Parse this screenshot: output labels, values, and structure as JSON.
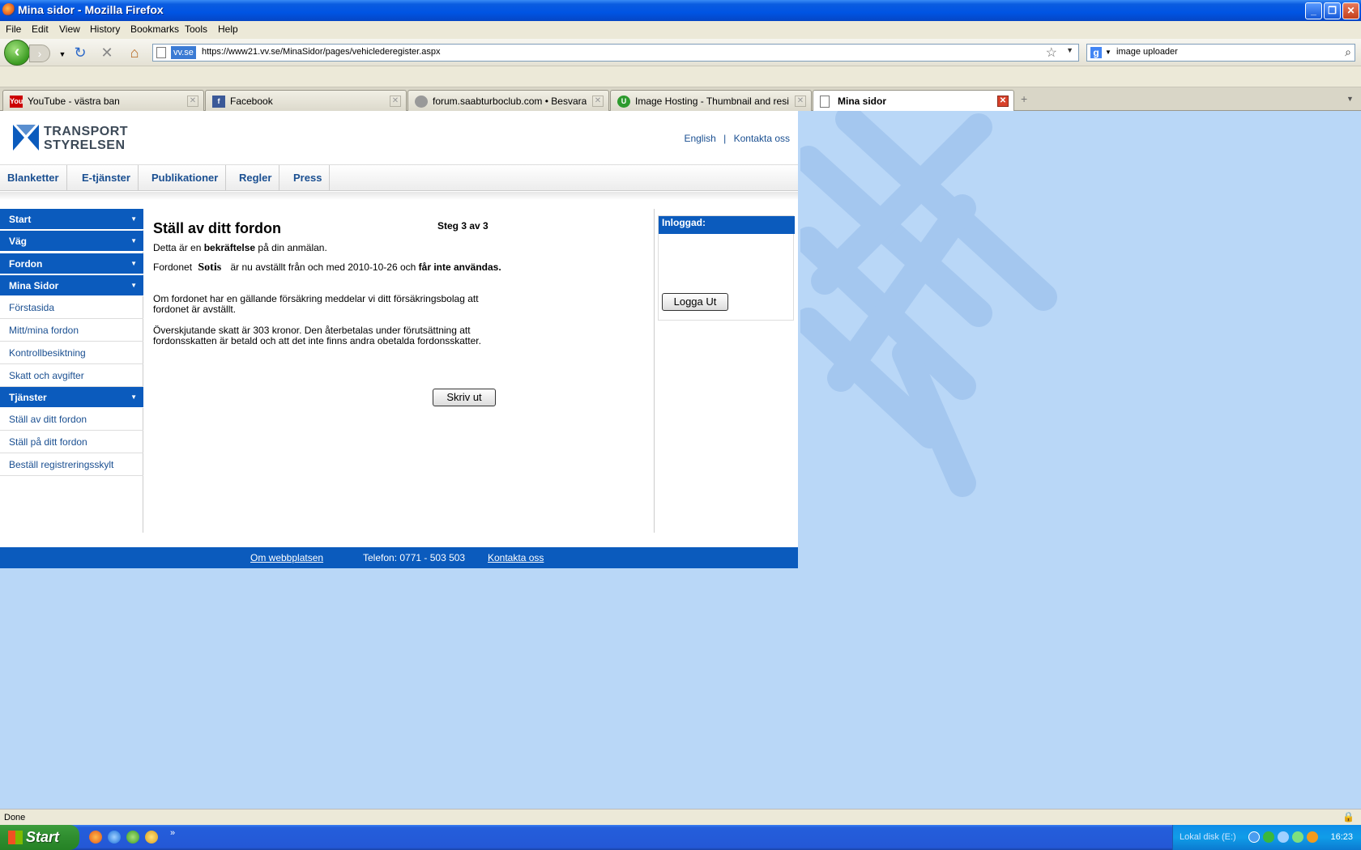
{
  "window": {
    "title": "Mina sidor - Mozilla Firefox"
  },
  "menu": [
    "File",
    "Edit",
    "View",
    "History",
    "Bookmarks",
    "Tools",
    "Help"
  ],
  "navbar": {
    "site_badge": "vv.se",
    "url": "https://www21.vv.se/MinaSidor/pages/vehiclederegister.aspx",
    "search_value": "image uploader"
  },
  "tabs": [
    {
      "label": "YouTube - västra ban",
      "icon": "youtube-icon"
    },
    {
      "label": "Facebook",
      "icon": "facebook-icon"
    },
    {
      "label": "forum.saabturboclub.com • Besvara",
      "icon": "globe-icon"
    },
    {
      "label": "Image Hosting - Thumbnail and resize y...",
      "icon": "tinypic-icon"
    },
    {
      "label": "Mina sidor",
      "icon": "page-icon",
      "active": true
    }
  ],
  "site": {
    "logo_line1": "TRANSPORT",
    "logo_line2": "STYRELSEN",
    "top_links": [
      "English",
      "Kontakta oss"
    ],
    "main_nav": [
      "Blanketter",
      "E-tjänster",
      "Publikationer",
      "Regler",
      "Press"
    ],
    "sidebar": {
      "start": "Start",
      "vag": "Väg",
      "fordon": "Fordon",
      "mina_sidor": "Mina Sidor",
      "mina_items": [
        "Förstasida",
        "Mitt/mina fordon",
        "Kontrollbesiktning",
        "Skatt och avgifter"
      ],
      "tjanster": "Tjänster",
      "tjanster_items": [
        "Ställ av ditt fordon",
        "Ställ på ditt fordon",
        "Beställ registreringsskylt"
      ]
    },
    "main": {
      "title": "Ställ av ditt fordon",
      "step": "Steg 3 av 3",
      "confirm_pre": "Detta är en ",
      "confirm_bold": "bekräftelse",
      "confirm_post": " på din anmälan.",
      "vehicle_pre": "Fordonet ",
      "vehicle_name": "Sotis",
      "vehicle_mid": " är nu avställt från och med 2010-10-26 och ",
      "vehicle_bold": "får inte användas.",
      "insurance": "Om fordonet har en gällande försäkring meddelar vi ditt försäkringsbolag att fordonet är avställt.",
      "tax": "Överskjutande skatt är 303 kronor. Den återbetalas under förutsättning att fordonsskatten är betald och att det inte finns andra obetalda fordonsskatter.",
      "print_button": "Skriv ut"
    },
    "login": {
      "heading": "Inloggad:",
      "logout_button": "Logga Ut"
    },
    "footer": {
      "about": "Om webbplatsen",
      "phone": "Telefon: 0771 - 503 503",
      "contact": "Kontakta oss"
    }
  },
  "status": {
    "text": "Done"
  },
  "taskbar": {
    "start": "Start",
    "disk": "Lokal disk (E:)",
    "clock": "16:23"
  },
  "colors": {
    "brand_blue": "#0b5bbd",
    "link_blue": "#1a4f91",
    "desktop_blue": "#b9d7f7"
  }
}
